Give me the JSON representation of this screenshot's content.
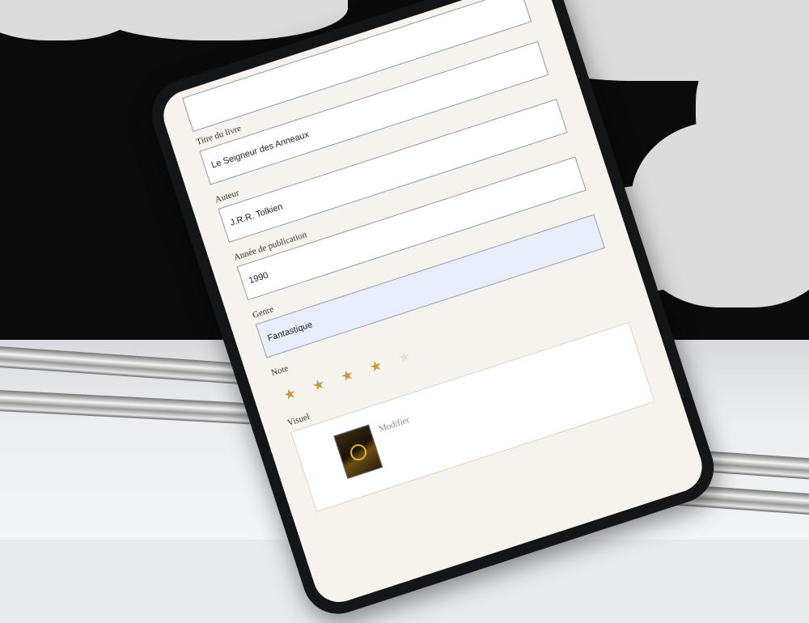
{
  "form": {
    "title_label": "Titre du livre",
    "title_value": "Le Seigneur des Anneaux",
    "author_label": "Auteur",
    "author_value": "J.R.R. Tolkien",
    "year_label": "Année de publication",
    "year_value": "1990",
    "genre_label": "Genre",
    "genre_value": "Fantastique",
    "rating_label": "Note",
    "rating": {
      "value": 4,
      "max": 5
    },
    "visual_label": "Visuel",
    "modify_label": "Modifier"
  },
  "colors": {
    "screen_background": "#f6f2ed",
    "star_active": "#c89a44",
    "star_inactive": "#eadfcc",
    "focused_input": "#e8effb"
  },
  "icons": {
    "star": "star-icon"
  }
}
